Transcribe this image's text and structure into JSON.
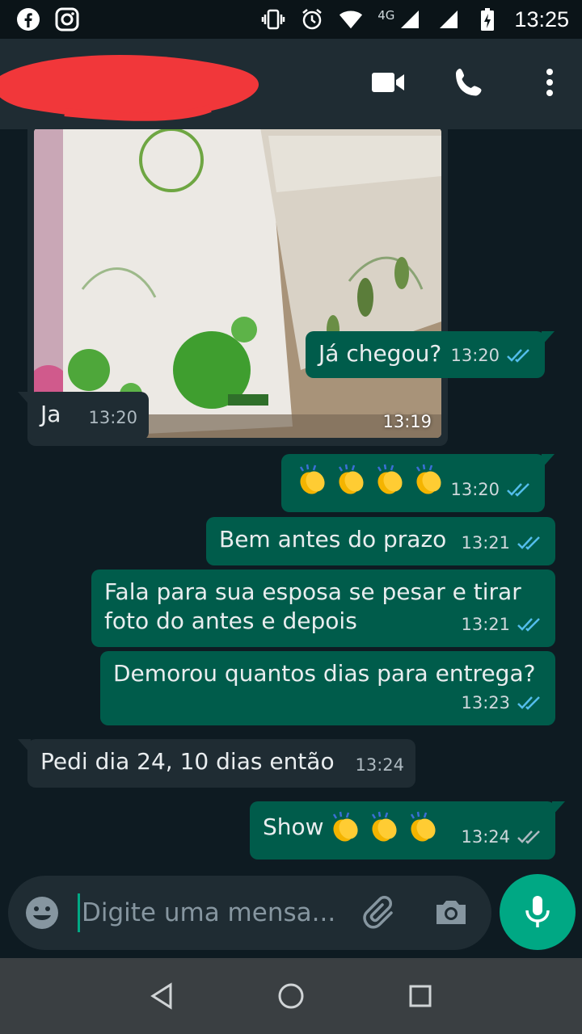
{
  "status_bar": {
    "time": "13:25",
    "network_label": "4G",
    "icons": [
      "facebook-icon",
      "instagram-icon",
      "vibrate-icon",
      "alarm-icon",
      "wifi-icon",
      "signal-icon",
      "signal-icon",
      "battery-charging-icon"
    ]
  },
  "header": {
    "contact_name_redacted": true,
    "actions": [
      "video-call-icon",
      "voice-call-icon",
      "more-options-icon"
    ]
  },
  "messages": [
    {
      "type": "image",
      "direction": "in",
      "time": "13:19"
    },
    {
      "type": "text",
      "direction": "out",
      "text": "Já chegou?",
      "time": "13:20",
      "status": "read"
    },
    {
      "type": "text",
      "direction": "in",
      "text": "Ja",
      "time": "13:20"
    },
    {
      "type": "emoji",
      "direction": "out",
      "emoji": "👏👏👏👏",
      "time": "13:20",
      "status": "read"
    },
    {
      "type": "text",
      "direction": "out",
      "text": "Bem antes do prazo",
      "time": "13:21",
      "status": "read"
    },
    {
      "type": "text",
      "direction": "out",
      "line1": "Fala para sua esposa se pesar e tirar",
      "line2": "foto do antes e depois",
      "time": "13:21",
      "status": "read"
    },
    {
      "type": "text",
      "direction": "out",
      "text": "Demorou quantos dias para entrega?",
      "time": "13:23",
      "status": "read"
    },
    {
      "type": "text",
      "direction": "in",
      "text": "Pedi dia 24, 10 dias então",
      "time": "13:24"
    },
    {
      "type": "text",
      "direction": "out",
      "text": "Show",
      "emoji": "👏👏👏",
      "time": "13:24",
      "status": "delivered"
    }
  ],
  "composer": {
    "placeholder": "Digite uma mensa...",
    "value": ""
  },
  "colors": {
    "background": "#0e1b22",
    "header": "#1f2c33",
    "outgoing_bubble": "#005c4b",
    "incoming_bubble": "#1f2c33",
    "accent": "#00a884",
    "read_tick": "#53bdeb"
  }
}
